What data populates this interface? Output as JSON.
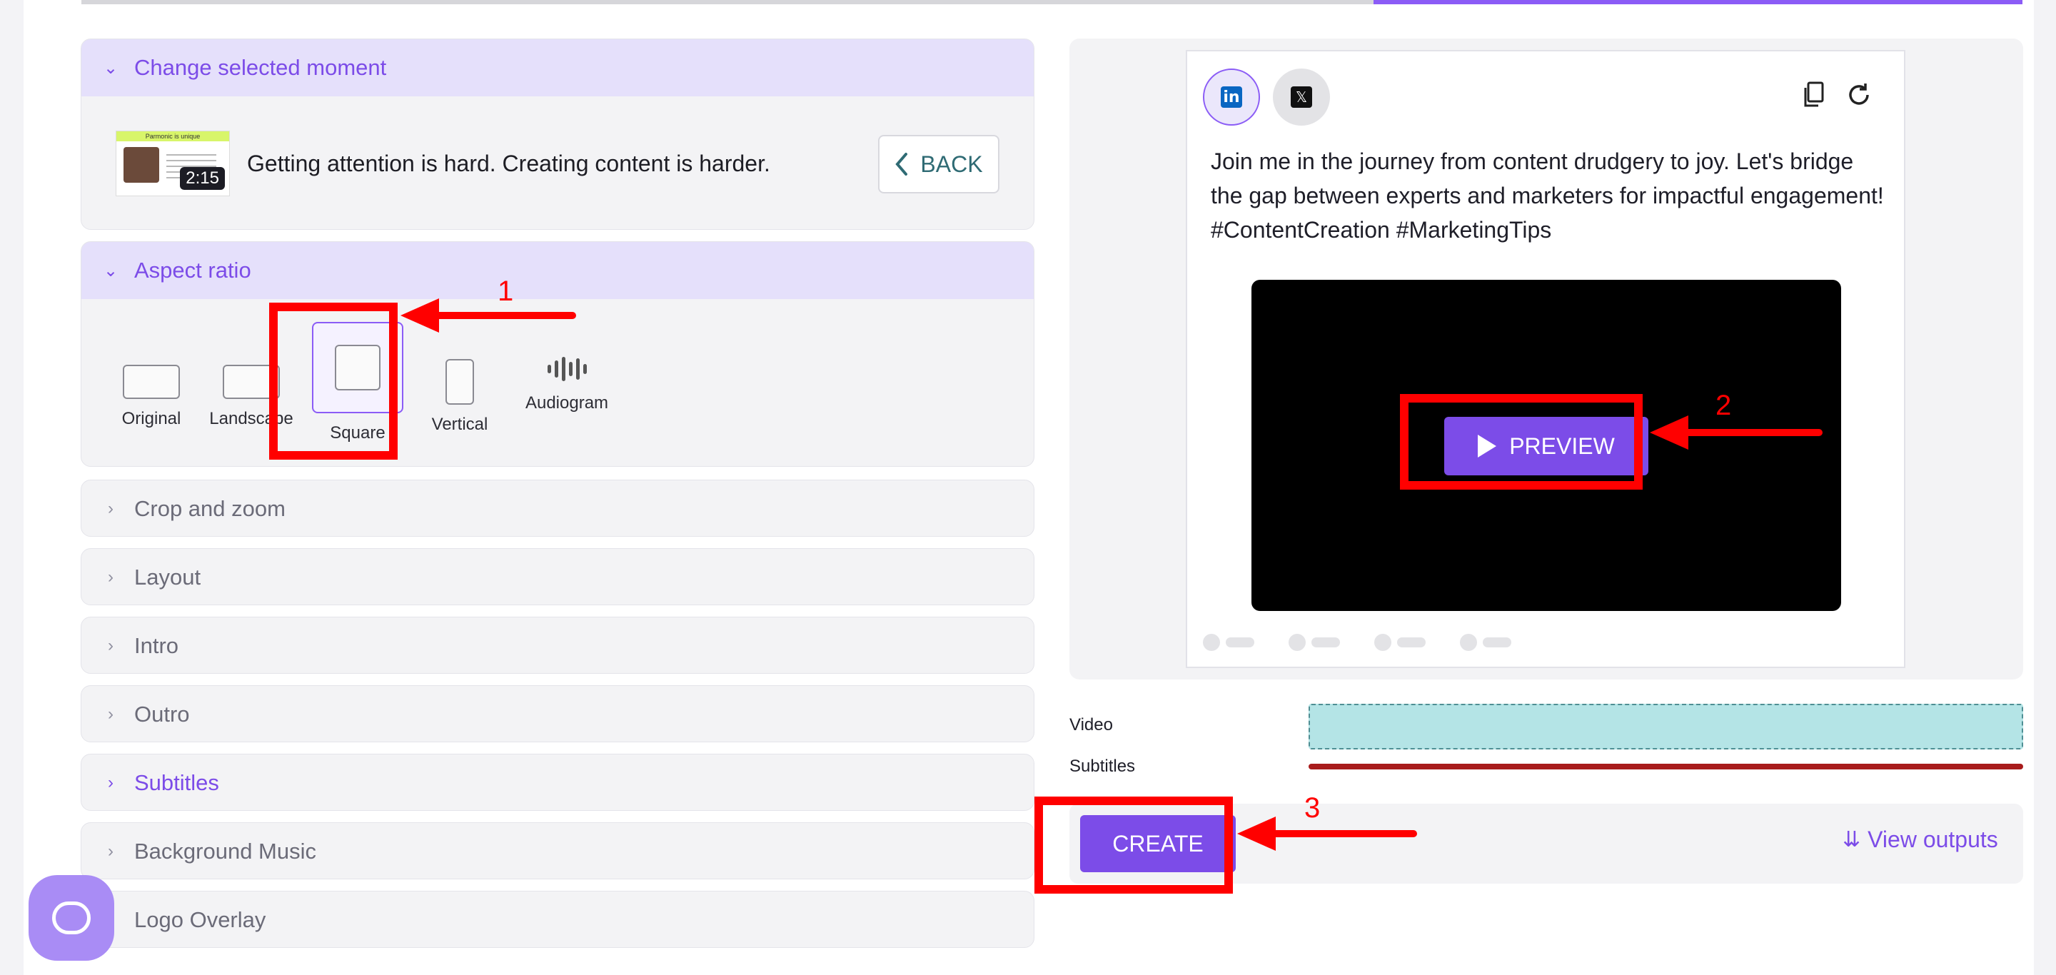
{
  "sections": {
    "change_moment": {
      "title": "Change selected moment",
      "thumb_header": "Parmonic is unique",
      "duration": "2:15",
      "moment_text": "Getting attention is hard. Creating content is harder.",
      "back_label": "BACK"
    },
    "aspect_ratio": {
      "title": "Aspect ratio",
      "options": [
        "Original",
        "Landscape",
        "Square",
        "Vertical",
        "Audiogram"
      ],
      "selected": "Square"
    },
    "collapsed": [
      "Crop and zoom",
      "Layout",
      "Intro",
      "Outro",
      "Subtitles",
      "Background Music",
      "Logo Overlay"
    ]
  },
  "preview": {
    "post_text": "Join me in the journey from content drudgery to joy. Let's bridge the gap between experts and marketers for impactful engagement! #ContentCreation #MarketingTips",
    "preview_label": "PREVIEW",
    "networks": [
      "linkedin",
      "x"
    ]
  },
  "timeline": {
    "video_label": "Video",
    "subtitles_label": "Subtitles"
  },
  "actions": {
    "create_label": "CREATE",
    "view_outputs_label": "View outputs"
  },
  "annotations": [
    "1",
    "2",
    "3"
  ],
  "colors": {
    "accent": "#7c4ce8",
    "highlight": "#ff0000",
    "video_track": "#b4e4e6",
    "subtitles_track": "#a81c1c"
  },
  "icons": {
    "linkedin": "linkedin-icon",
    "x": "x-icon",
    "copy": "copy-icon",
    "refresh": "refresh-icon",
    "chat": "chat-icon"
  }
}
